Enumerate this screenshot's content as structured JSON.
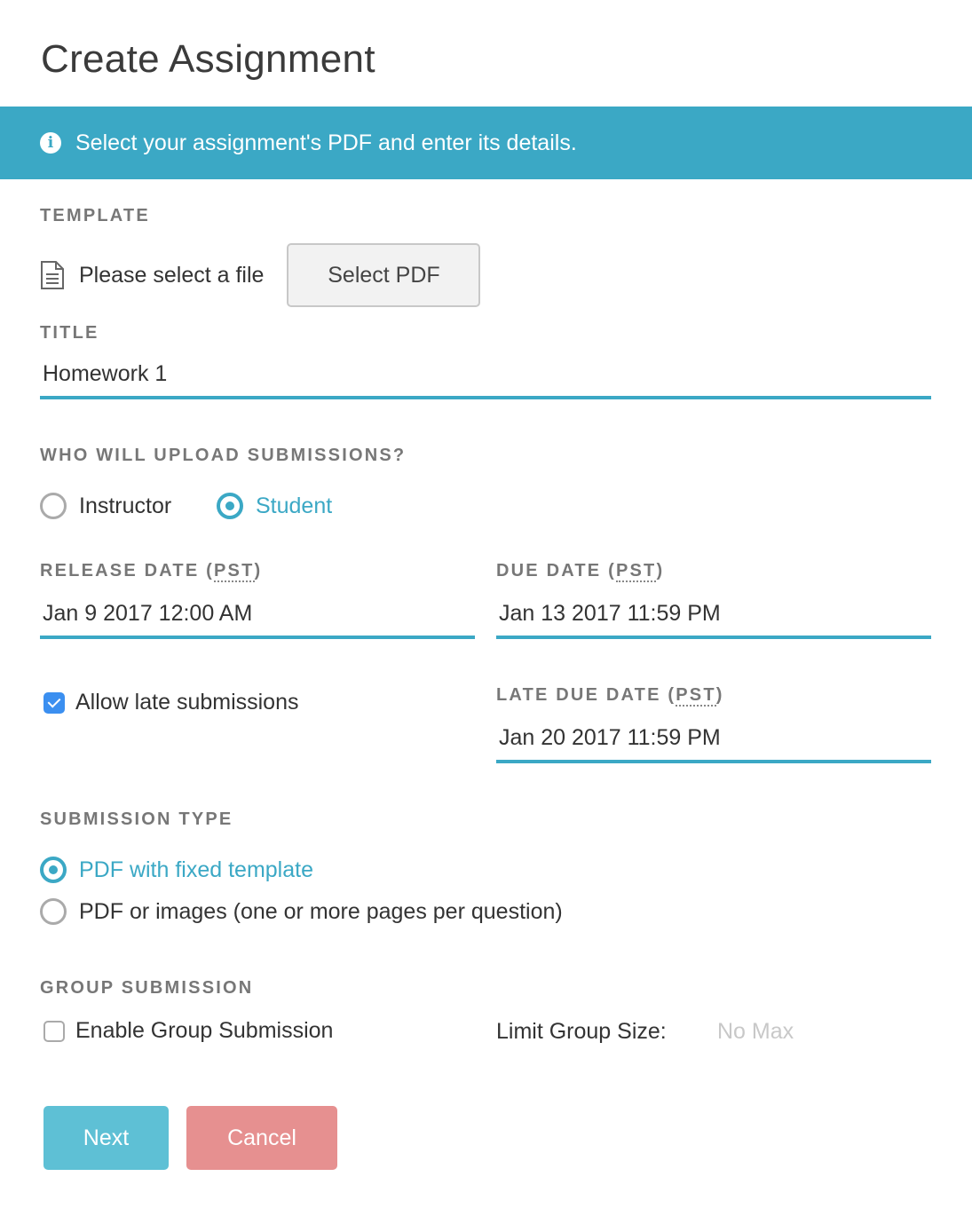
{
  "page": {
    "title": "Create Assignment"
  },
  "banner": {
    "icon": "info-icon",
    "text": "Select your assignment's PDF and enter its details."
  },
  "template": {
    "label": "TEMPLATE",
    "file_icon": "document-icon",
    "file_status": "Please select a file",
    "select_button": "Select PDF"
  },
  "title_field": {
    "label": "TITLE",
    "value": "Homework 1"
  },
  "uploader": {
    "label": "WHO WILL UPLOAD SUBMISSIONS?",
    "options": [
      {
        "label": "Instructor",
        "selected": false
      },
      {
        "label": "Student",
        "selected": true
      }
    ]
  },
  "release_date": {
    "label": "RELEASE DATE (",
    "tz": "PST",
    "label_end": ")",
    "value": "Jan 9 2017 12:00 AM"
  },
  "due_date": {
    "label": "DUE DATE (",
    "tz": "PST",
    "label_end": ")",
    "value": "Jan 13 2017 11:59 PM"
  },
  "late": {
    "checkbox_label": "Allow late submissions",
    "checked": true,
    "label": "LATE DUE DATE (",
    "tz": "PST",
    "label_end": ")",
    "value": "Jan 20 2017 11:59 PM"
  },
  "submission_type": {
    "label": "SUBMISSION TYPE",
    "options": [
      {
        "label": "PDF with fixed template",
        "selected": true
      },
      {
        "label": "PDF or images (one or more pages per question)",
        "selected": false
      }
    ]
  },
  "group": {
    "label": "GROUP SUBMISSION",
    "checkbox_label": "Enable Group Submission",
    "checked": false,
    "limit_label": "Limit Group Size:",
    "limit_placeholder": "No Max"
  },
  "actions": {
    "next": "Next",
    "cancel": "Cancel"
  },
  "colors": {
    "accent": "#3ba8c5",
    "next": "#5ec0d5",
    "cancel": "#e69090",
    "checkbox": "#3b8ff0"
  }
}
